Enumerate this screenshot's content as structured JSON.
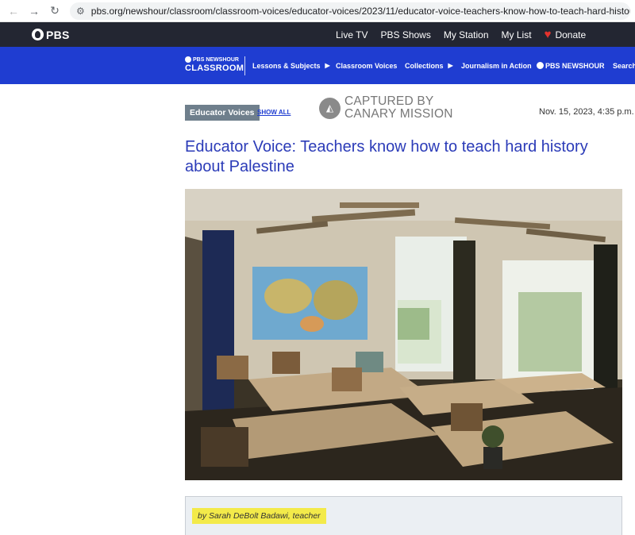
{
  "browser": {
    "back_icon": "←",
    "forward_icon": "→",
    "reload_icon": "↻",
    "url": "pbs.org/newshour/classroom/classroom-voices/educator-voices/2023/11/educator-voice-teachers-know-how-to-teach-hard-history-about-palestine"
  },
  "pbs_bar": {
    "logo": "PBS",
    "nav": [
      "Live TV",
      "PBS Shows",
      "My Station",
      "My List"
    ],
    "donate": "Donate",
    "colors": {
      "background": "#232632",
      "heart": "#e5322d"
    }
  },
  "classroom_bar": {
    "logo_small": "PBS NEWSHOUR",
    "logo_big": "CLASSROOM",
    "nav": {
      "lessons": "Lessons & Subjects",
      "voices": "Classroom Voices",
      "collections": "Collections",
      "journalism": "Journalism in Action",
      "newshour": "PBS NEWSHOUR",
      "search": "Search"
    },
    "arrow_icon": "▶",
    "color": "#1f3dd1"
  },
  "article": {
    "category": "Educator Voices",
    "show_all": "SHOW ALL",
    "watermark_line1": "CAPTURED BY",
    "watermark_line2": "CANARY MISSION",
    "date": "Nov. 15, 2023, 4:35 p.m.",
    "title": "Educator Voice: Teachers know how to teach hard history about Palestine",
    "byline": "by Sarah DeBolt Badawi, teacher",
    "title_color": "#2b3bb8"
  }
}
